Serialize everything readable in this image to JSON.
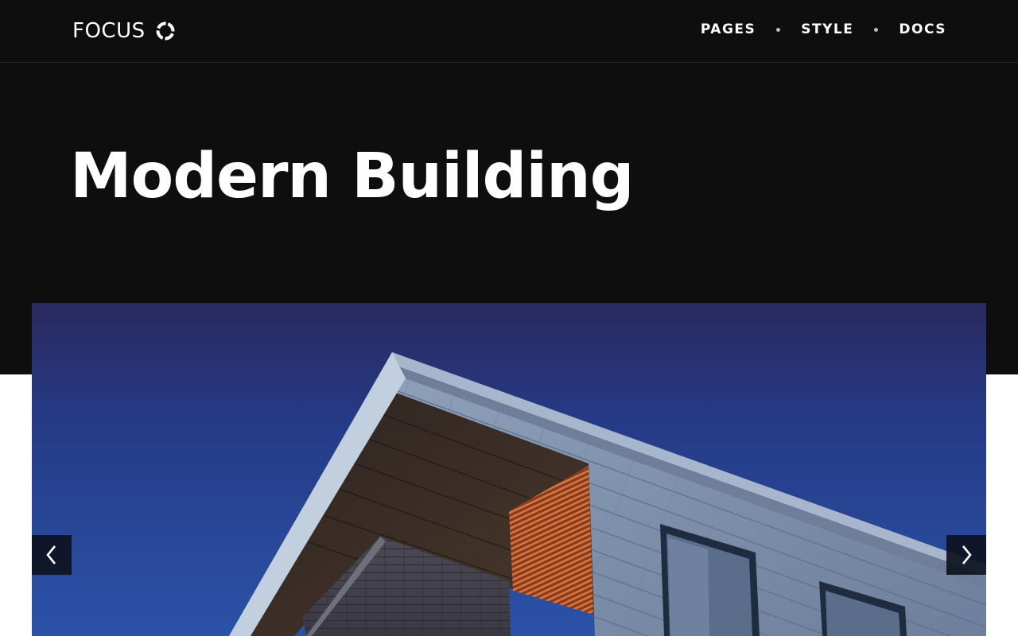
{
  "header": {
    "logo_text": "FOCUS",
    "logo_icon": "ring-icon",
    "nav": [
      {
        "label": "PAGES"
      },
      {
        "label": "STYLE"
      },
      {
        "label": "DOCS"
      }
    ]
  },
  "hero": {
    "title": "Modern Building"
  },
  "slider": {
    "image": "modern-building-photo",
    "prev_icon": "chevron-left-icon",
    "next_icon": "chevron-right-icon"
  },
  "colors": {
    "header_bg": "#0e0e0e",
    "page_bg": "#ffffff",
    "text": "#ffffff",
    "sky": "#2a3f8f"
  }
}
